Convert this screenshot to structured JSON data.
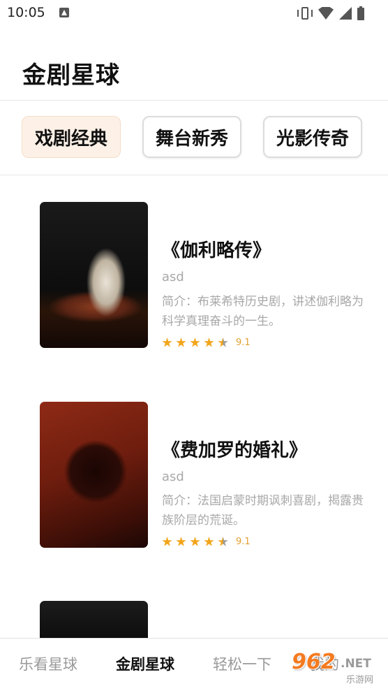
{
  "status_bar": {
    "time": "10:05"
  },
  "header": {
    "title": "金剧星球"
  },
  "category_tabs": [
    {
      "label": "戏剧经典",
      "active": true
    },
    {
      "label": "舞台新秀",
      "active": false
    },
    {
      "label": "光影传奇",
      "active": false
    }
  ],
  "plays": [
    {
      "title": "《伽利略传》",
      "subtitle": "asd",
      "description": "简介：布莱希特历史剧，讲述伽利略为科学真理奋斗的一生。",
      "stars": 4.5,
      "score": "9.1"
    },
    {
      "title": "《费加罗的婚礼》",
      "subtitle": "asd",
      "description": "简介：法国启蒙时期讽刺喜剧，揭露贵族阶层的荒诞。",
      "stars": 4.5,
      "score": "9.1"
    }
  ],
  "bottom_nav": [
    {
      "label": "乐看星球",
      "active": false
    },
    {
      "label": "金剧星球",
      "active": true
    },
    {
      "label": "轻松一下",
      "active": false
    },
    {
      "label": "我的",
      "active": false
    }
  ],
  "watermark": {
    "number": "962",
    "suffix": ".NET",
    "site": "乐游网"
  },
  "colors": {
    "accent_tab_bg": "#fdf1e7",
    "star": "#f2a51a",
    "score": "#e3a030",
    "muted": "#a8a8a8"
  }
}
